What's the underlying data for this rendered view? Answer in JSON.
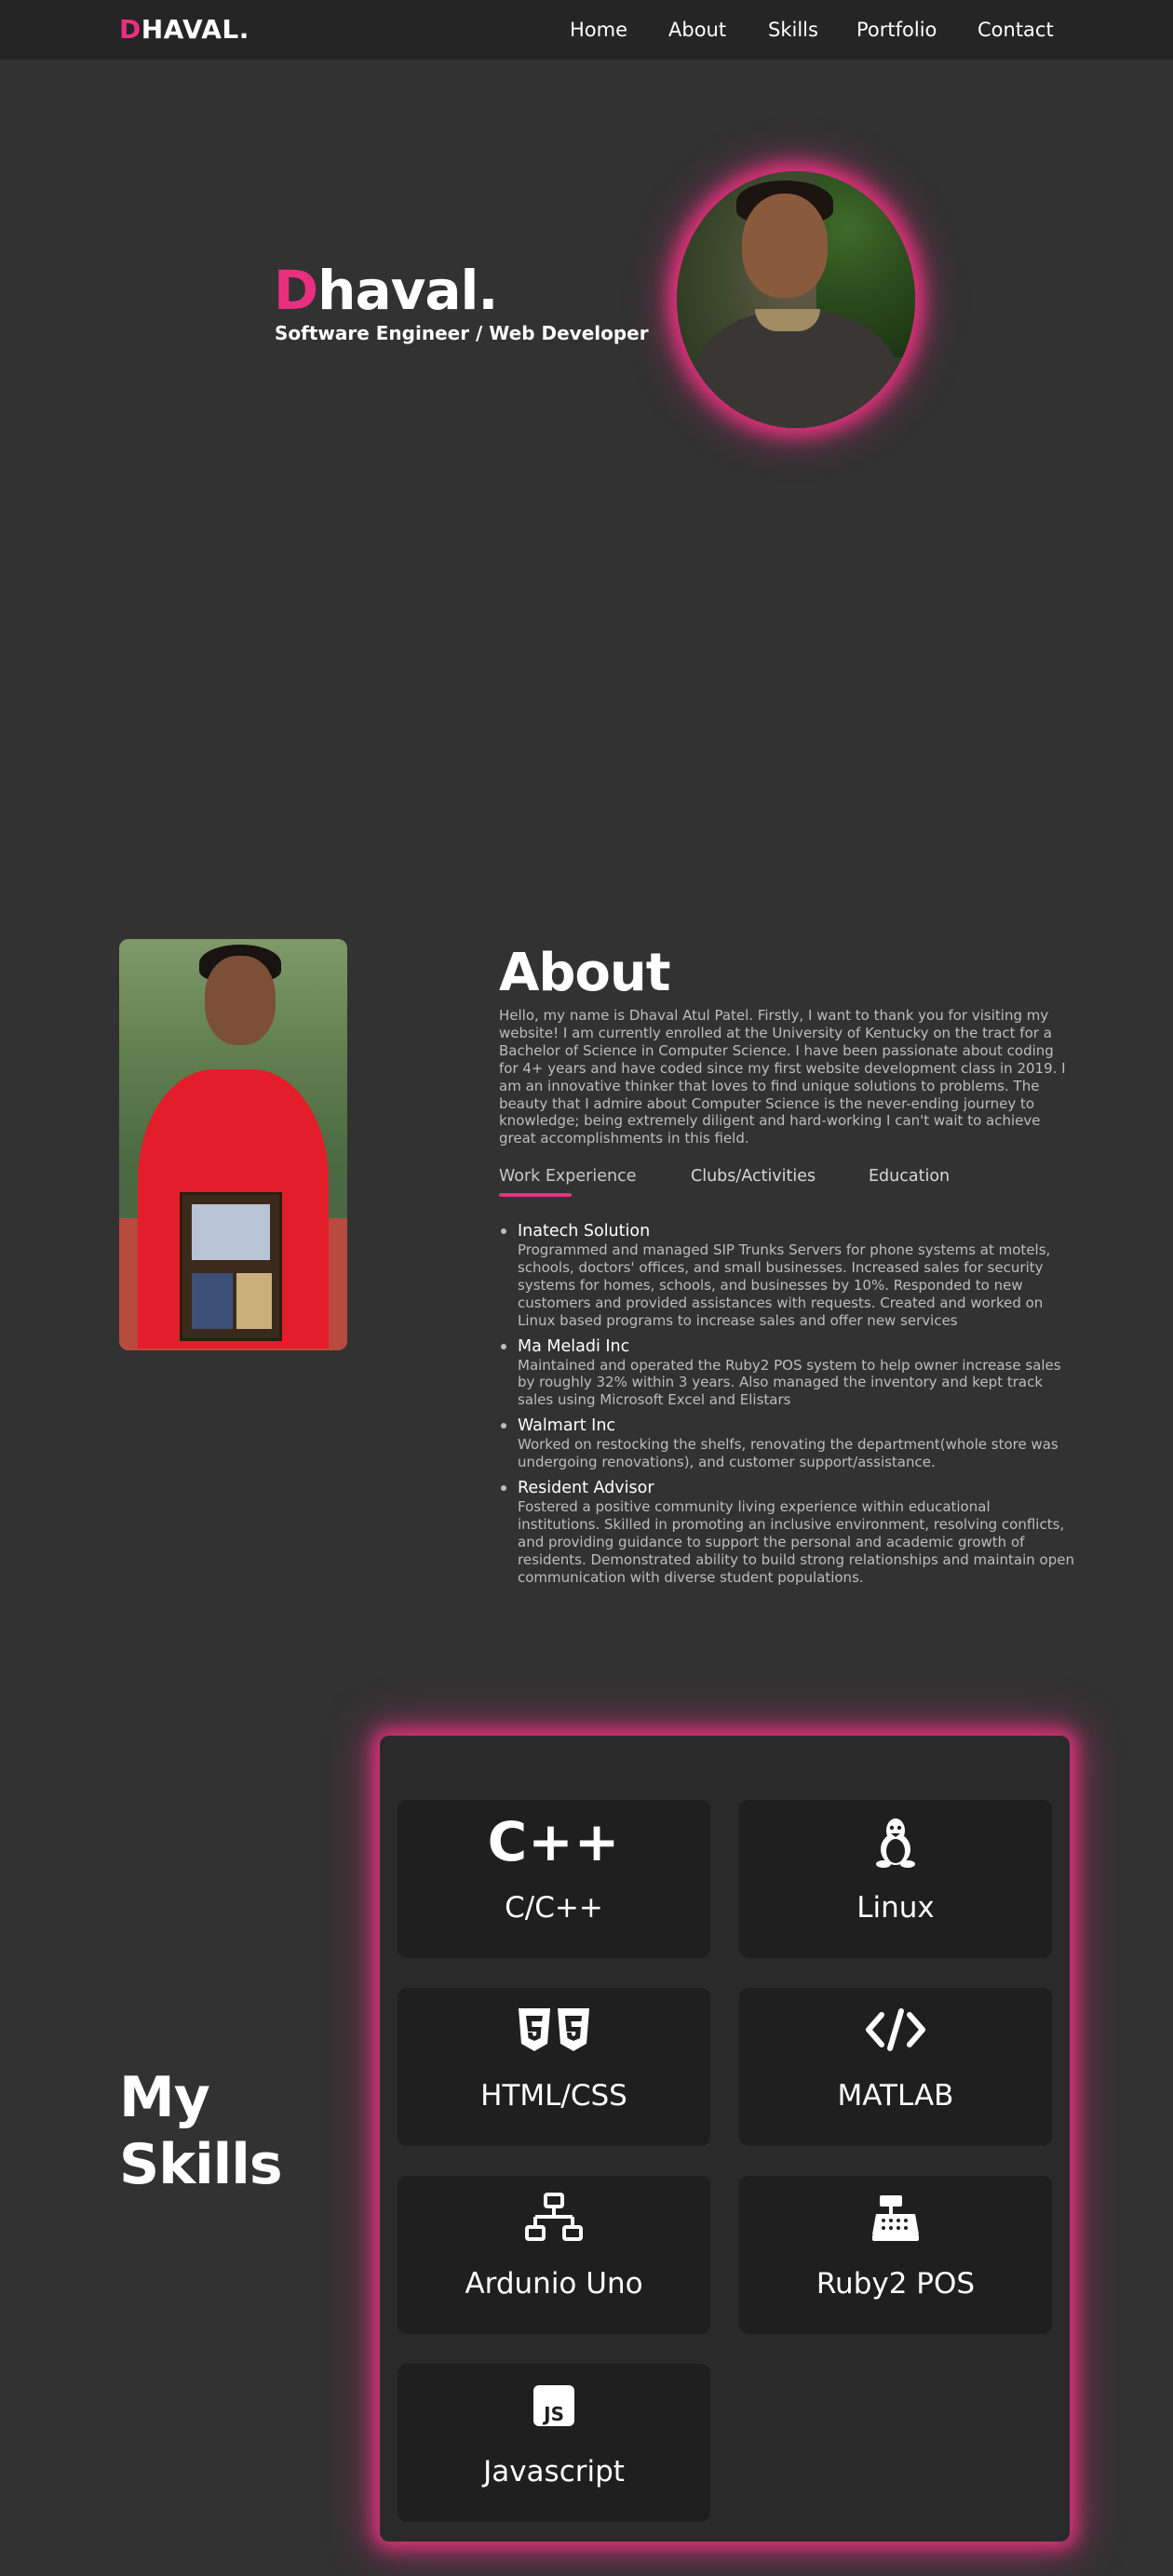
{
  "navbar": {
    "logo_accent": "D",
    "logo_rest": "HAVAL.",
    "links": [
      "Home",
      "About",
      "Skills",
      "Portfolio",
      "Contact"
    ]
  },
  "hero": {
    "name_accent": "D",
    "name_rest": "haval.",
    "subtitle": "Software Engineer / Web Developer"
  },
  "about": {
    "title": "About",
    "text": "Hello, my name is Dhaval Atul Patel. Firstly, I want to thank you for visiting my website! I am currently enrolled at the University of Kentucky on the tract for a Bachelor of Science in Computer Science. I have been passionate about coding for 4+ years and have coded since my first website development class in 2019. I am an innovative thinker that loves to find unique solutions to problems. The beauty that I admire about Computer Science is the never-ending journey to knowledge; being extremely diligent and hard-working I can't wait to achieve great accomplishments in this field.",
    "tabs": [
      "Work Experience",
      "Clubs/Activities",
      "Education"
    ],
    "experience": [
      {
        "title": "Inatech Solution",
        "desc": "Programmed and managed SIP Trunks Servers for phone systems at motels, schools, doctors' offices, and small businesses. Increased sales for security systems for homes, schools, and businesses by 10%. Responded to new customers and provided assistances with requests. Created and worked on Linux based programs to increase sales and offer new services"
      },
      {
        "title": "Ma Meladi Inc",
        "desc": "Maintained and operated the Ruby2 POS system to help owner increase sales by roughly 32% within 3 years. Also managed the inventory and kept track sales using Microsoft Excel and Elistars"
      },
      {
        "title": "Walmart Inc",
        "desc": "Worked on restocking the shelfs, renovating the department(whole store was undergoing renovations), and customer support/assistance."
      },
      {
        "title": "Resident Advisor",
        "desc": "Fostered a positive community living experience within educational institutions. Skilled in promoting an inclusive environment, resolving conflicts, and providing guidance to support the personal and academic growth of residents. Demonstrated ability to build strong relationships and maintain open communication with diverse student populations."
      }
    ]
  },
  "skills": {
    "title_line1": "My",
    "title_line2": "Skills",
    "cards": [
      {
        "label": "C/C++",
        "icon": "cpp-icon",
        "glyph": "C++"
      },
      {
        "label": "Linux",
        "icon": "linux-icon"
      },
      {
        "label": "HTML/CSS",
        "icon": "html5-css3-icon"
      },
      {
        "label": "MATLAB",
        "icon": "code-icon"
      },
      {
        "label": "Ardunio Uno",
        "icon": "network-icon"
      },
      {
        "label": "Ruby2 POS",
        "icon": "cash-register-icon"
      },
      {
        "label": "Javascript",
        "icon": "js-icon"
      }
    ]
  },
  "colors": {
    "accent": "#ea2f80",
    "background": "#323232",
    "navbar": "#252525",
    "card": "#1f1f1f",
    "muted_text": "#bdbdbd"
  }
}
